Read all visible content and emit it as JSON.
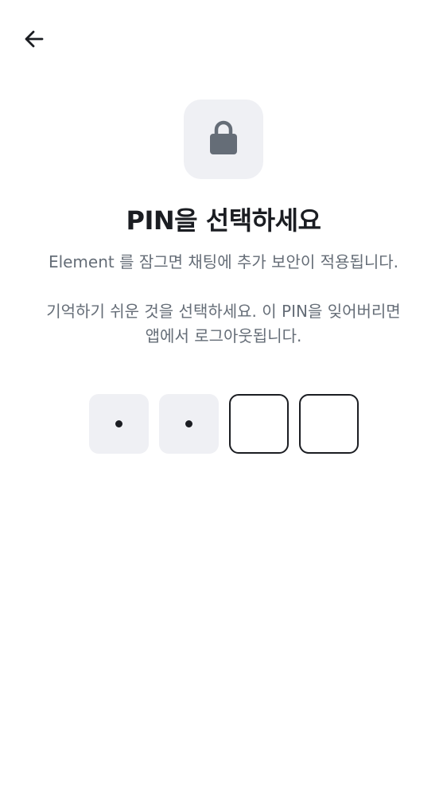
{
  "header": {
    "back_icon": "arrow-left-icon"
  },
  "lock": {
    "icon": "lock-icon",
    "tile_color": "#EFF0F4",
    "icon_color": "#656D77"
  },
  "title": "PIN을 선택하세요",
  "description": {
    "line1": "Element 를 잠그면 채팅에 추가 보안이 적용됩니다.",
    "line2a": "기억하기 쉬운 것을 선택하세요. 이 PIN을 잊어버리면",
    "line2b": "앱에서 로그아웃됩니다."
  },
  "pin": {
    "length": 4,
    "entered_count": 2,
    "cells": [
      "filled",
      "filled",
      "empty",
      "empty"
    ]
  },
  "colors": {
    "text_primary": "#1B1D22",
    "text_secondary": "#656D77",
    "surface": "#EFF0F4"
  }
}
